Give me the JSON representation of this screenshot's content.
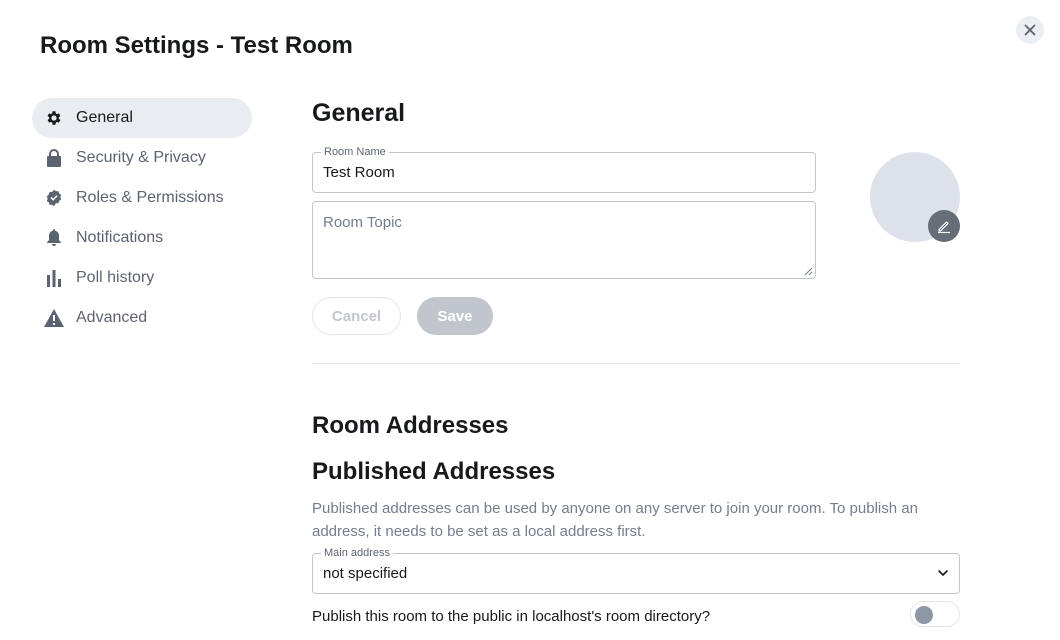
{
  "dialog": {
    "title": "Room Settings - Test Room",
    "close_icon": "close-icon"
  },
  "sidebar": {
    "items": [
      {
        "label": "General",
        "icon": "gear-icon",
        "active": true
      },
      {
        "label": "Security & Privacy",
        "icon": "lock-icon",
        "active": false
      },
      {
        "label": "Roles & Permissions",
        "icon": "badge-check-icon",
        "active": false
      },
      {
        "label": "Notifications",
        "icon": "bell-icon",
        "active": false
      },
      {
        "label": "Poll history",
        "icon": "bar-chart-icon",
        "active": false
      },
      {
        "label": "Advanced",
        "icon": "warning-icon",
        "active": false
      }
    ]
  },
  "general": {
    "heading": "General",
    "room_name_label": "Room Name",
    "room_name_value": "Test Room",
    "room_topic_placeholder": "Room Topic",
    "cancel_label": "Cancel",
    "save_label": "Save"
  },
  "addresses": {
    "heading": "Room Addresses",
    "published_heading": "Published Addresses",
    "description": "Published addresses can be used by anyone on any server to join your room. To publish an address, it needs to be set as a local address first.",
    "main_address_label": "Main address",
    "main_address_value": "not specified",
    "publish_label": "Publish this room to the public in localhost's room directory?",
    "publish_enabled": false
  },
  "colors": {
    "accent_text": "#17191c",
    "muted_text": "#737d8c",
    "avatar_bg": "#dde2ea",
    "disabled_button": "#c1c6cd"
  }
}
